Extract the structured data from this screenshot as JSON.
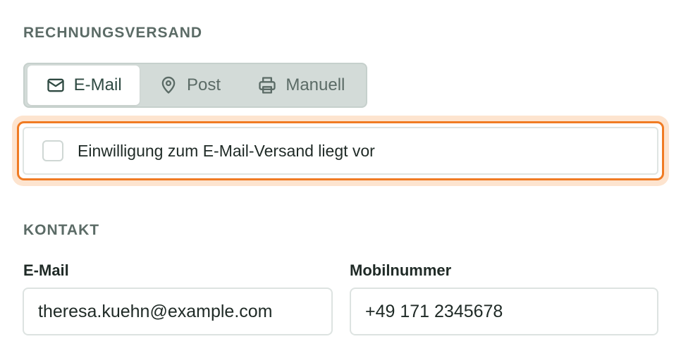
{
  "billing": {
    "section_title": "RECHNUNGSVERSAND",
    "options": [
      {
        "label": "E-Mail",
        "icon": "mail-icon",
        "selected": true
      },
      {
        "label": "Post",
        "icon": "map-pin-icon",
        "selected": false
      },
      {
        "label": "Manuell",
        "icon": "printer-icon",
        "selected": false
      }
    ],
    "consent": {
      "label": "Einwilligung zum E-Mail-Versand liegt vor",
      "checked": false,
      "highlight_color": "#f07b23"
    }
  },
  "contact": {
    "section_title": "KONTAKT",
    "email": {
      "label": "E-Mail",
      "value": "theresa.kuehn@example.com"
    },
    "mobile": {
      "label": "Mobilnummer",
      "value": "+49 171 2345678"
    }
  },
  "colors": {
    "accent": "#f07b23",
    "section_title": "#5b6b66",
    "segment_background": "#d3dbd8"
  }
}
